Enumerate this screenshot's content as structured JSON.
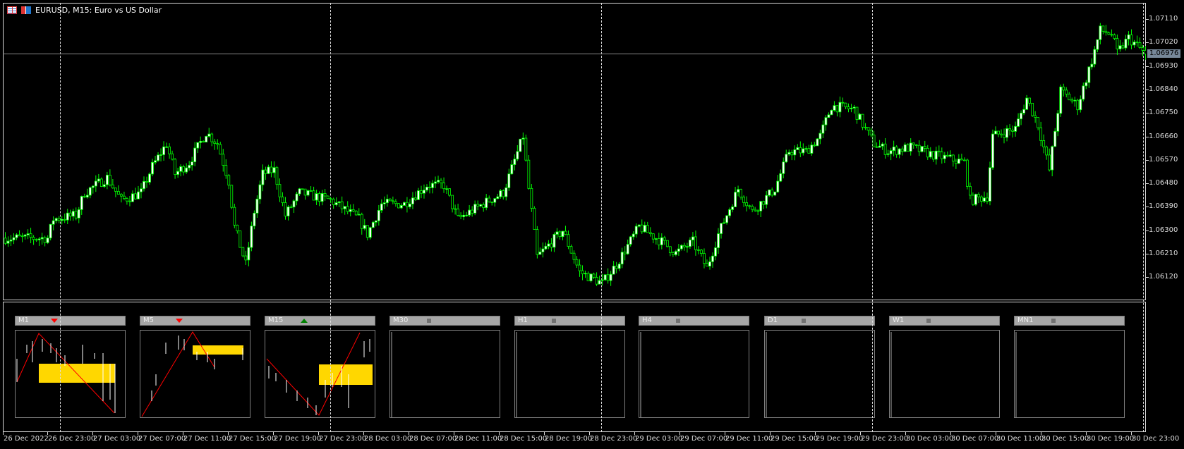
{
  "window": {
    "title": "EURUSD, M15:  Euro vs US Dollar"
  },
  "price_axis": {
    "labels": [
      "1.07110",
      "1.07020",
      "1.06930",
      "1.06840",
      "1.06750",
      "1.06660",
      "1.06570",
      "1.06480",
      "1.06390",
      "1.06300",
      "1.06210",
      "1.06120"
    ],
    "current_price": "1.06976"
  },
  "time_axis": {
    "labels": [
      "26 Dec 2022",
      "26 Dec 23:00",
      "27 Dec 03:00",
      "27 Dec 07:00",
      "27 Dec 11:00",
      "27 Dec 15:00",
      "27 Dec 19:00",
      "27 Dec 23:00",
      "28 Dec 03:00",
      "28 Dec 07:00",
      "28 Dec 11:00",
      "28 Dec 15:00",
      "28 Dec 19:00",
      "28 Dec 23:00",
      "29 Dec 03:00",
      "29 Dec 07:00",
      "29 Dec 11:00",
      "29 Dec 15:00",
      "29 Dec 19:00",
      "29 Dec 23:00",
      "30 Dec 03:00",
      "30 Dec 07:00",
      "30 Dec 11:00",
      "30 Dec 15:00",
      "30 Dec 19:00",
      "30 Dec 23:00"
    ]
  },
  "colors": {
    "candle": "#00ff00",
    "up_arrow": "#008000",
    "down_arrow": "#ff0000",
    "zone": "#ffd700",
    "zigzag": "#ff0000"
  },
  "price_path": [
    [
      1,
      1.0627
    ],
    [
      15,
      1.0627
    ],
    [
      17,
      1.06343
    ],
    [
      25,
      1.06357
    ],
    [
      28,
      1.06444
    ],
    [
      36,
      1.06502
    ],
    [
      41,
      1.06415
    ],
    [
      48,
      1.06444
    ],
    [
      52,
      1.06545
    ],
    [
      57,
      1.06632
    ],
    [
      60,
      1.06516
    ],
    [
      65,
      1.0656
    ],
    [
      71,
      1.06676
    ],
    [
      75,
      1.06632
    ],
    [
      79,
      1.06488
    ],
    [
      81,
      1.06314
    ],
    [
      85,
      1.06169
    ],
    [
      88,
      1.06372
    ],
    [
      91,
      1.06516
    ],
    [
      95,
      1.06531
    ],
    [
      99,
      1.06357
    ],
    [
      104,
      1.06444
    ],
    [
      115,
      1.06415
    ],
    [
      125,
      1.06343
    ],
    [
      128,
      1.06285
    ],
    [
      133,
      1.06401
    ],
    [
      141,
      1.06401
    ],
    [
      149,
      1.06473
    ],
    [
      155,
      1.06473
    ],
    [
      160,
      1.06343
    ],
    [
      171,
      1.06415
    ],
    [
      176,
      1.06444
    ],
    [
      183,
      1.06661
    ],
    [
      185,
      1.06459
    ],
    [
      188,
      1.06198
    ],
    [
      197,
      1.06299
    ],
    [
      203,
      1.0614
    ],
    [
      211,
      1.06097
    ],
    [
      216,
      1.06169
    ],
    [
      224,
      1.06314
    ],
    [
      232,
      1.06256
    ],
    [
      237,
      1.06213
    ],
    [
      243,
      1.06256
    ],
    [
      248,
      1.06155
    ],
    [
      252,
      1.06285
    ],
    [
      259,
      1.06459
    ],
    [
      264,
      1.06372
    ],
    [
      272,
      1.06459
    ],
    [
      277,
      1.06603
    ],
    [
      283,
      1.06603
    ],
    [
      288,
      1.06661
    ],
    [
      292,
      1.06777
    ],
    [
      300,
      1.06763
    ],
    [
      307,
      1.06632
    ],
    [
      312,
      1.06603
    ],
    [
      320,
      1.06618
    ],
    [
      328,
      1.06589
    ],
    [
      339,
      1.0656
    ],
    [
      341,
      1.06415
    ],
    [
      347,
      1.0643
    ],
    [
      349,
      1.06661
    ],
    [
      357,
      1.0669
    ],
    [
      361,
      1.06806
    ],
    [
      365,
      1.06705
    ],
    [
      369,
      1.06531
    ],
    [
      373,
      1.06835
    ],
    [
      379,
      1.06777
    ],
    [
      384,
      1.06951
    ],
    [
      387,
      1.07067
    ],
    [
      391,
      1.07052
    ],
    [
      393,
      1.0698
    ],
    [
      397,
      1.07038
    ],
    [
      403,
      1.06976
    ]
  ],
  "panels": [
    {
      "label": "M1",
      "signal": "down"
    },
    {
      "label": "M5",
      "signal": "down"
    },
    {
      "label": "M15",
      "signal": "up"
    },
    {
      "label": "M30",
      "signal": "none"
    },
    {
      "label": "H1",
      "signal": "none"
    },
    {
      "label": "H4",
      "signal": "none"
    },
    {
      "label": "D1",
      "signal": "none"
    },
    {
      "label": "W1",
      "signal": "none"
    },
    {
      "label": "MN1",
      "signal": "none"
    }
  ]
}
